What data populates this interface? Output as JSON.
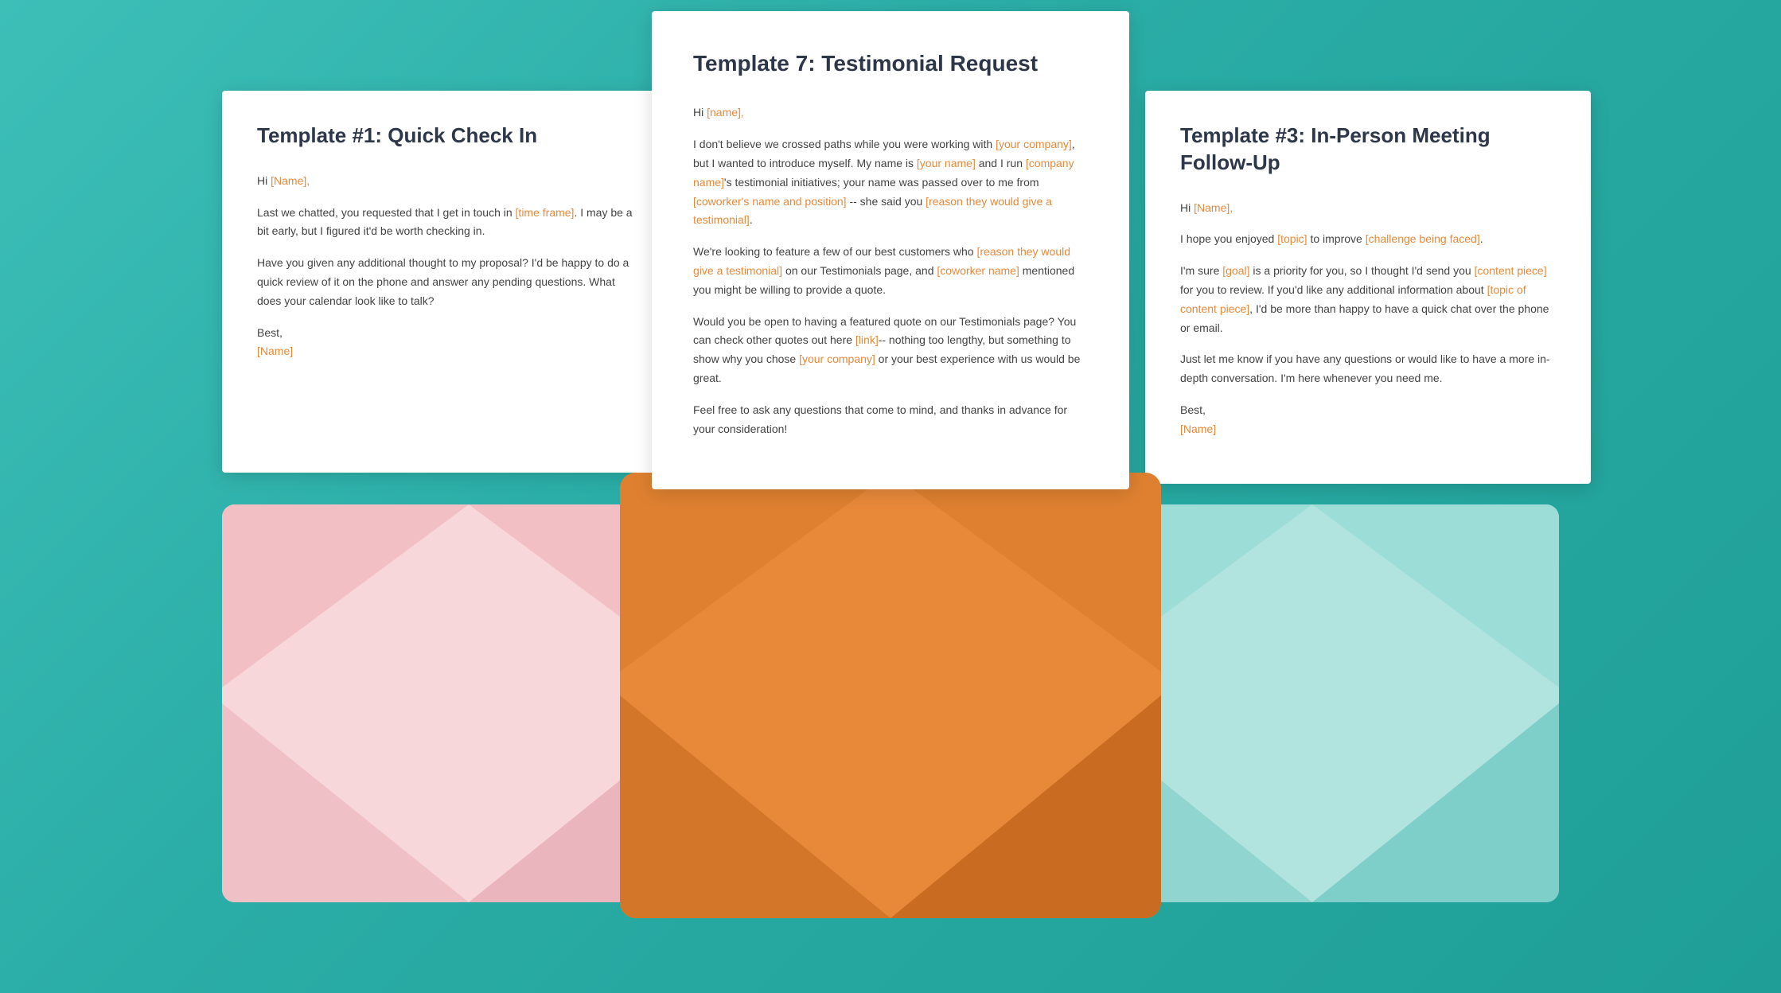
{
  "background": {
    "color": "#3dbfb8"
  },
  "left_card": {
    "title": "Template #1: Quick Check In",
    "body": [
      {
        "type": "paragraph",
        "segments": [
          {
            "text": "Hi ",
            "style": "normal"
          },
          {
            "text": "[Name],",
            "style": "placeholder"
          }
        ]
      },
      {
        "type": "paragraph",
        "segments": [
          {
            "text": "Last we chatted, you requested that I get in touch in ",
            "style": "normal"
          },
          {
            "text": "[time frame]",
            "style": "placeholder"
          },
          {
            "text": ". I may be a bit early, but I figured it'd be worth checking in.",
            "style": "normal"
          }
        ]
      },
      {
        "type": "paragraph",
        "segments": [
          {
            "text": "Have you given any additional thought to my proposal? I'd be happy to do a quick review of it on the phone and answer any pending questions. What does your calendar look like to talk?",
            "style": "normal"
          }
        ]
      },
      {
        "type": "signoff",
        "line1": "Best,",
        "line2_placeholder": "[Name]"
      }
    ]
  },
  "center_card": {
    "title": "Template 7: Testimonial Request",
    "body": [
      {
        "type": "paragraph",
        "segments": [
          {
            "text": "Hi ",
            "style": "normal"
          },
          {
            "text": "[name],",
            "style": "placeholder"
          }
        ]
      },
      {
        "type": "paragraph",
        "segments": [
          {
            "text": "I don't believe we crossed paths while you were working with ",
            "style": "normal"
          },
          {
            "text": "[your company]",
            "style": "placeholder"
          },
          {
            "text": ", but I wanted to introduce myself. My name is ",
            "style": "normal"
          },
          {
            "text": "[your name]",
            "style": "placeholder"
          },
          {
            "text": " and I run ",
            "style": "normal"
          },
          {
            "text": "[company name]",
            "style": "placeholder"
          },
          {
            "text": "'s testimonial initiatives; your name was passed over to me from ",
            "style": "normal"
          },
          {
            "text": "[coworker's name and position]",
            "style": "placeholder"
          },
          {
            "text": " -- she said you ",
            "style": "normal"
          },
          {
            "text": "[reason they would give a testimonial]",
            "style": "placeholder"
          },
          {
            "text": ".",
            "style": "normal"
          }
        ]
      },
      {
        "type": "paragraph",
        "segments": [
          {
            "text": "We're looking to feature a few of our best customers who ",
            "style": "normal"
          },
          {
            "text": "[reason they would give a testimonial]",
            "style": "placeholder"
          },
          {
            "text": " on our Testimonials page, and ",
            "style": "normal"
          },
          {
            "text": "[coworker name]",
            "style": "placeholder"
          },
          {
            "text": " mentioned you might be willing to provide a quote.",
            "style": "normal"
          }
        ]
      },
      {
        "type": "paragraph",
        "segments": [
          {
            "text": "Would you be open to having a featured quote on our Testimonials page? You can check other quotes out here ",
            "style": "normal"
          },
          {
            "text": "[link]",
            "style": "placeholder"
          },
          {
            "text": "-- nothing too lengthy, but something to show why you chose ",
            "style": "normal"
          },
          {
            "text": "[your company]",
            "style": "placeholder"
          },
          {
            "text": " or your best experience with us would be great.",
            "style": "normal"
          }
        ]
      },
      {
        "type": "paragraph",
        "segments": [
          {
            "text": "Feel free to ask any questions that come to mind, and thanks in advance for your consideration!",
            "style": "normal"
          }
        ]
      }
    ]
  },
  "right_card": {
    "title": "Template #3: In-Person Meeting Follow-Up",
    "body": [
      {
        "type": "paragraph",
        "segments": [
          {
            "text": "Hi ",
            "style": "normal"
          },
          {
            "text": "[Name],",
            "style": "placeholder"
          }
        ]
      },
      {
        "type": "paragraph",
        "segments": [
          {
            "text": "I hope you enjoyed ",
            "style": "normal"
          },
          {
            "text": "[topic]",
            "style": "placeholder"
          },
          {
            "text": " to improve ",
            "style": "normal"
          },
          {
            "text": "[challenge being faced]",
            "style": "placeholder"
          },
          {
            "text": ".",
            "style": "normal"
          }
        ]
      },
      {
        "type": "paragraph",
        "segments": [
          {
            "text": "I'm sure ",
            "style": "normal"
          },
          {
            "text": "[goal]",
            "style": "placeholder"
          },
          {
            "text": " is a priority for you, so I thought I'd send you ",
            "style": "normal"
          },
          {
            "text": "[content piece]",
            "style": "placeholder"
          },
          {
            "text": " for you to review. If you'd like any additional information about ",
            "style": "normal"
          },
          {
            "text": "[topic of content piece]",
            "style": "placeholder"
          },
          {
            "text": ", I'd be more than happy to have a quick chat over the phone or email.",
            "style": "normal"
          }
        ]
      },
      {
        "type": "paragraph",
        "segments": [
          {
            "text": "Just let me know if you have any questions or would like to have a more in-depth conversation. I'm here whenever you need me.",
            "style": "normal"
          }
        ]
      },
      {
        "type": "signoff",
        "line1": "Best,",
        "line2_placeholder": "[Name]"
      }
    ]
  },
  "colors": {
    "background_start": "#3dbfb8",
    "background_end": "#1e9e96",
    "placeholder": "#e8893a",
    "text_dark": "#2d3748",
    "text_body": "#444444",
    "envelope_left_bg": "#f8d7da",
    "envelope_left_tri1": "#f0c0c7",
    "envelope_left_tri2": "#eab5bc",
    "envelope_left_tri3": "#f2bfc5",
    "envelope_right_bg": "#b2e4df",
    "envelope_right_tri1": "#90d5d0",
    "envelope_right_tri2": "#7ecec9",
    "envelope_right_tri3": "#9dddd8",
    "envelope_center_bg": "#e8893a",
    "envelope_center_tri1": "#d4762a",
    "envelope_center_tri2": "#c96c22",
    "envelope_center_tri3": "#de8030"
  }
}
